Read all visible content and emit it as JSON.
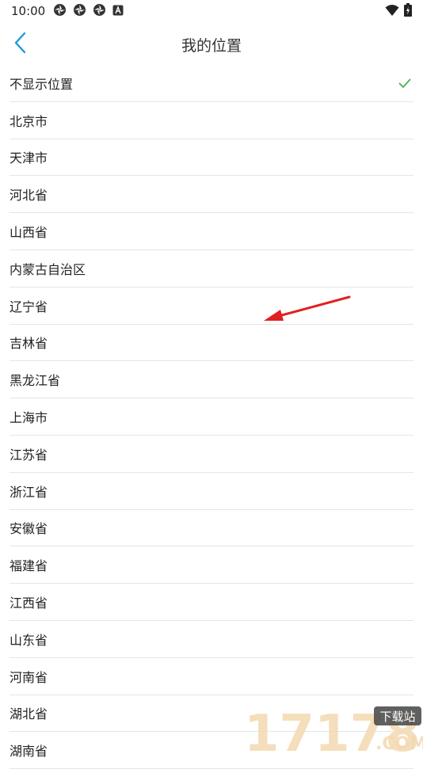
{
  "status_bar": {
    "time": "10:00",
    "left_icons": [
      "app-icon",
      "app-icon",
      "app-icon",
      "notification-a-icon"
    ],
    "right_icons": [
      "wifi-icon",
      "battery-icon"
    ]
  },
  "header": {
    "back_icon": "chevron-left-icon",
    "title": "我的位置"
  },
  "colors": {
    "accent": "#1a9bd7",
    "check": "#4caf50",
    "divider": "#e5e5e5",
    "arrow": "#e02020"
  },
  "locations": [
    {
      "label": "不显示位置",
      "selected": true
    },
    {
      "label": "北京市",
      "selected": false
    },
    {
      "label": "天津市",
      "selected": false
    },
    {
      "label": "河北省",
      "selected": false
    },
    {
      "label": "山西省",
      "selected": false
    },
    {
      "label": "内蒙古自治区",
      "selected": false
    },
    {
      "label": "辽宁省",
      "selected": false
    },
    {
      "label": "吉林省",
      "selected": false
    },
    {
      "label": "黑龙江省",
      "selected": false
    },
    {
      "label": "上海市",
      "selected": false
    },
    {
      "label": "江苏省",
      "selected": false
    },
    {
      "label": "浙江省",
      "selected": false
    },
    {
      "label": "安徽省",
      "selected": false
    },
    {
      "label": "福建省",
      "selected": false
    },
    {
      "label": "江西省",
      "selected": false
    },
    {
      "label": "山东省",
      "selected": false
    },
    {
      "label": "河南省",
      "selected": false
    },
    {
      "label": "湖北省",
      "selected": false
    },
    {
      "label": "湖南省",
      "selected": false
    }
  ],
  "watermark": {
    "text": "17178",
    "badge": "下载站",
    "suffix": ".COM"
  }
}
